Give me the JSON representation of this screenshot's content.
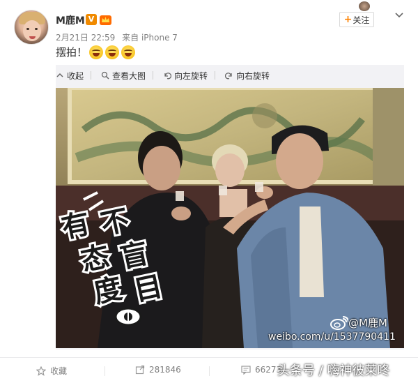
{
  "post": {
    "username": "M鹿M",
    "verified_badge": "V",
    "date": "2月21日 22:59",
    "source": "来自 iPhone 7",
    "text": "摆拍！",
    "emoji_count": 3,
    "emoji_icon": "laughing-tears-emoji"
  },
  "header": {
    "follow_plus": "+",
    "follow_label": "关注",
    "more_icon": "chevron-down-icon"
  },
  "media_toolbar": {
    "collapse": "收起",
    "view_large": "查看大图",
    "rotate_left": "向左旋转",
    "rotate_right": "向右旋转"
  },
  "photo": {
    "overlay_chars": [
      "有",
      "态",
      "度",
      "不",
      "盲",
      "目"
    ],
    "watermark_user": "@M鹿M",
    "watermark_url": "weibo.com/u/1537790411"
  },
  "footer": {
    "favorite": "收藏",
    "repost_count": "281846",
    "comment_count": "66273",
    "credit": "头条号 / 嗨神彼莱咚"
  },
  "colors": {
    "accent_orange": "#ff8200",
    "badge_orange": "#f08a00",
    "text_gray": "#808080",
    "media_bg": "#f2f2f5"
  }
}
